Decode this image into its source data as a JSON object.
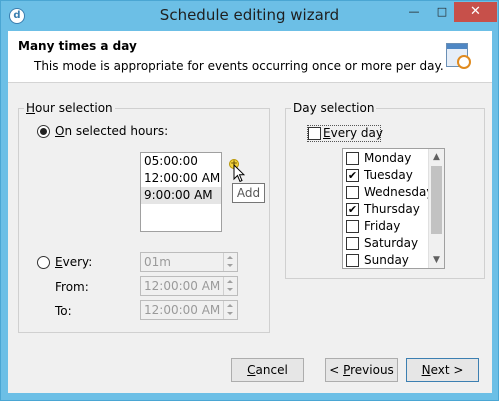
{
  "window": {
    "title": "Schedule editing wizard",
    "app_icon_glyph": "d",
    "minimize_glyph": "—",
    "maximize_glyph": "□",
    "close_glyph": "✕"
  },
  "header": {
    "title": "Many times a day",
    "description": "This mode is appropriate for events occurring once or more per day.",
    "icon": "calendar-clock-icon"
  },
  "hour_selection": {
    "group_label_first": "H",
    "group_label_rest": "our selection",
    "on_selected_hours_label_first": "O",
    "on_selected_hours_label_rest": "n selected hours:",
    "on_selected_hours_checked": true,
    "hours": [
      "05:00:00",
      "12:00:00 AM",
      "9:00:00 AM"
    ],
    "selected_hour_index": 2,
    "add_tooltip": "Add",
    "add_glyph": "+",
    "every_label_first": "E",
    "every_label_rest": "very:",
    "every_checked": false,
    "every_value": "01m",
    "from_label": "From:",
    "from_value": "12:00:00 AM",
    "to_label": "To:",
    "to_value": "12:00:00 AM"
  },
  "day_selection": {
    "group_label": "Day selection",
    "every_day_label_first": "E",
    "every_day_label_rest": "very day",
    "every_day_checked": false,
    "days": [
      {
        "label": "Monday",
        "checked": false,
        "mark": ""
      },
      {
        "label": "Tuesday",
        "checked": true,
        "mark": "✔"
      },
      {
        "label": "Wednesday",
        "checked": false,
        "mark": ""
      },
      {
        "label": "Thursday",
        "checked": true,
        "mark": "✔"
      },
      {
        "label": "Friday",
        "checked": false,
        "mark": ""
      },
      {
        "label": "Saturday",
        "checked": false,
        "mark": ""
      },
      {
        "label": "Sunday",
        "checked": false,
        "mark": ""
      }
    ]
  },
  "footer": {
    "cancel_first": "C",
    "cancel_rest": "ancel",
    "previous_prefix": "< ",
    "previous_first": "P",
    "previous_rest": "revious",
    "next_first": "N",
    "next_rest": "ext >"
  }
}
